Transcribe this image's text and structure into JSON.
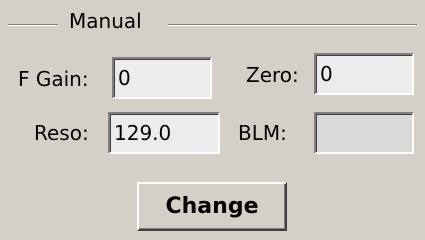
{
  "group": {
    "title": "Manual"
  },
  "fields": {
    "f_gain": {
      "label": "F Gain:",
      "value": "0"
    },
    "zero": {
      "label": "Zero:",
      "value": "0"
    },
    "reso": {
      "label": "Reso:",
      "value": "129.0"
    },
    "blm": {
      "label": "BLM:",
      "value": ""
    }
  },
  "actions": {
    "change_label": "Change"
  }
}
